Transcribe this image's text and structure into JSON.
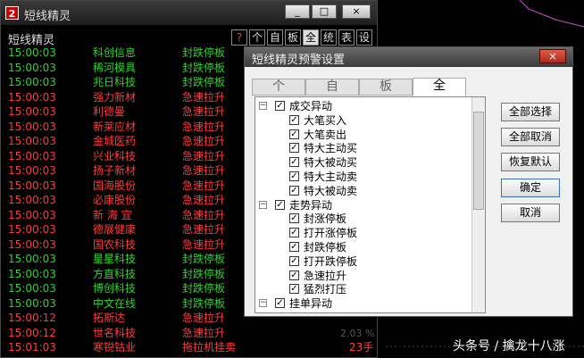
{
  "main": {
    "title": "短线精灵",
    "window_buttons": [
      "_",
      "□",
      "×"
    ],
    "panel_title": "短线精灵",
    "toolbar": [
      "?",
      "个",
      "自",
      "板",
      "全",
      "统",
      "表",
      "设"
    ],
    "rows": [
      {
        "time": "15:00:03",
        "name": "科创信息",
        "type": "封跌停板",
        "color": "g"
      },
      {
        "time": "15:00:03",
        "name": "稀河模具",
        "type": "封跌停板",
        "color": "g"
      },
      {
        "time": "15:00:03",
        "name": "兆日科技",
        "type": "封跌停板",
        "color": "g"
      },
      {
        "time": "15:00:03",
        "name": "强力新材",
        "type": "急速拉升",
        "color": "r"
      },
      {
        "time": "15:00:03",
        "name": "利德曼",
        "type": "急速拉升",
        "color": "r"
      },
      {
        "time": "15:00:03",
        "name": "新莱应材",
        "type": "急速拉升",
        "color": "r"
      },
      {
        "time": "15:00:03",
        "name": "金城医药",
        "type": "急速拉升",
        "color": "r"
      },
      {
        "time": "15:00:03",
        "name": "兴业科技",
        "type": "急速拉升",
        "color": "r"
      },
      {
        "time": "15:00:03",
        "name": "扬子新材",
        "type": "急速拉升",
        "color": "r"
      },
      {
        "time": "15:00:03",
        "name": "国海股份",
        "type": "急速拉升",
        "color": "r"
      },
      {
        "time": "15:00:03",
        "name": "必康股份",
        "type": "急速拉升",
        "color": "r"
      },
      {
        "time": "15:00:03",
        "name": "新 海 宜",
        "type": "急速拉升",
        "color": "r"
      },
      {
        "time": "15:00:03",
        "name": "德展健康",
        "type": "急速拉升",
        "color": "r"
      },
      {
        "time": "15:00:03",
        "name": "国农科技",
        "type": "急速拉升",
        "color": "r"
      },
      {
        "time": "15:00:03",
        "name": "星星科技",
        "type": "封跌停板",
        "color": "g"
      },
      {
        "time": "15:00:03",
        "name": "方直科技",
        "type": "封跌停板",
        "color": "g"
      },
      {
        "time": "15:00:03",
        "name": "博创科技",
        "type": "封跌停板",
        "color": "g"
      },
      {
        "time": "15:00:03",
        "name": "中文在线",
        "type": "封跌停板",
        "color": "g"
      },
      {
        "time": "15:00:12",
        "name": "拓斯达",
        "type": "急速拉升",
        "color": "r"
      },
      {
        "time": "15:00:12",
        "name": "世名科技",
        "type": "急速拉升",
        "color": "r"
      },
      {
        "time": "15:01:03",
        "name": "寒锐钴业",
        "type": "拖拉机挂卖",
        "color": "r",
        "extra": "23手"
      }
    ],
    "faded_text": "2.03 %"
  },
  "dialog": {
    "title": "短线精灵预警设置",
    "close": "×",
    "tabs": [
      "个",
      "自",
      "板",
      "全"
    ],
    "tree": [
      {
        "label": "成交异动",
        "level": 0
      },
      {
        "label": "大笔买入",
        "level": 1
      },
      {
        "label": "大笔卖出",
        "level": 1
      },
      {
        "label": "特大主动买",
        "level": 1
      },
      {
        "label": "特大被动买",
        "level": 1
      },
      {
        "label": "特大主动卖",
        "level": 1
      },
      {
        "label": "特大被动卖",
        "level": 1
      },
      {
        "label": "走势异动",
        "level": 0
      },
      {
        "label": "封涨停板",
        "level": 1
      },
      {
        "label": "打开涨停板",
        "level": 1
      },
      {
        "label": "封跌停板",
        "level": 1
      },
      {
        "label": "打开跌停板",
        "level": 1
      },
      {
        "label": "急速拉升",
        "level": 1
      },
      {
        "label": "猛烈打压",
        "level": 1
      },
      {
        "label": "挂单异动",
        "level": 0
      }
    ],
    "buttons": [
      "全部选择",
      "全部取消",
      "恢复默认",
      "确定",
      "取消"
    ]
  },
  "watermark": "头条号 / 擒龙十八涨",
  "colors": {
    "green": "#2fd32f",
    "red": "#ff3b3b"
  }
}
